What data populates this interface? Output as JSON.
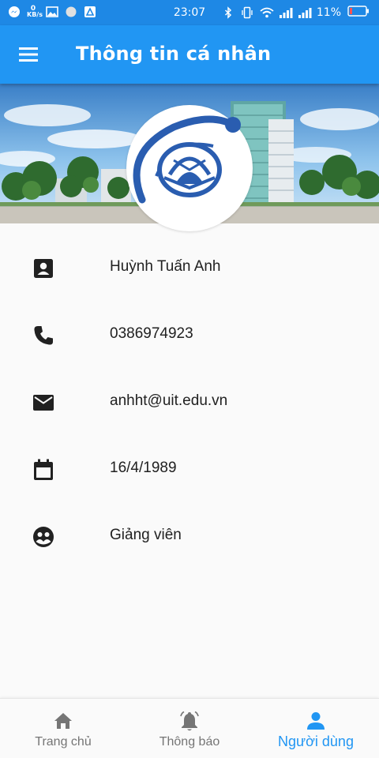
{
  "status_bar": {
    "time": "23:07",
    "battery": "11%",
    "kb_label": "KB/s",
    "left_icons": [
      "messenger-icon",
      "network-speed-icon",
      "image-icon",
      "circle-icon",
      "app-icon"
    ],
    "right_icons": [
      "bluetooth-icon",
      "vibrate-icon",
      "wifi-icon",
      "signal-icon",
      "signal-icon",
      "battery-icon"
    ]
  },
  "app_bar": {
    "title": "Thông tin cá nhân",
    "menu_icon": "menu-icon"
  },
  "banner": {
    "image": "campus-photo",
    "logo": "uit-logo"
  },
  "profile": {
    "items": [
      {
        "icon": "contact-card-icon",
        "value": "Huỳnh Tuấn Anh"
      },
      {
        "icon": "phone-icon",
        "value": "0386974923"
      },
      {
        "icon": "email-icon",
        "value": "anhht@uit.edu.vn"
      },
      {
        "icon": "calendar-icon",
        "value": "16/4/1989"
      },
      {
        "icon": "role-icon",
        "value": "Giảng viên"
      }
    ]
  },
  "bottom_nav": {
    "items": [
      {
        "label": "Trang chủ",
        "icon": "home-icon",
        "active": false
      },
      {
        "label": "Thông báo",
        "icon": "bell-icon",
        "active": false
      },
      {
        "label": "Người dùng",
        "icon": "person-icon",
        "active": true
      }
    ]
  },
  "colors": {
    "status_bar": "#1e88e5",
    "app_bar": "#2196f3",
    "accent": "#2196f3",
    "icon": "#212121",
    "inactive": "#757575",
    "background": "#fafafa"
  }
}
